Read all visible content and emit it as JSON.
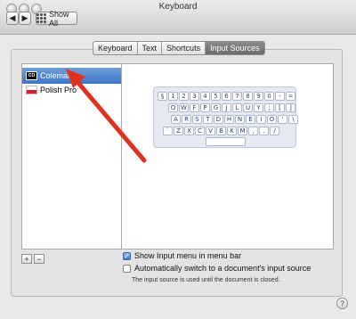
{
  "window": {
    "title": "Keyboard"
  },
  "toolbar": {
    "show_all_label": "Show All"
  },
  "tabs": [
    {
      "label": "Keyboard",
      "active": false
    },
    {
      "label": "Text",
      "active": false
    },
    {
      "label": "Shortcuts",
      "active": false
    },
    {
      "label": "Input Sources",
      "active": true
    }
  ],
  "input_sources": [
    {
      "badge": "CO",
      "label": "Colemak",
      "selected": true
    },
    {
      "badge": "PRO",
      "label": "Polish Pro",
      "selected": false
    }
  ],
  "keyboard_rows": [
    [
      "§",
      "1",
      "2",
      "3",
      "4",
      "5",
      "6",
      "7",
      "8",
      "9",
      "0",
      "-",
      "="
    ],
    [
      "Q",
      "W",
      "F",
      "P",
      "G",
      "J",
      "L",
      "U",
      "Y",
      ";",
      "[",
      "]"
    ],
    [
      "A",
      "R",
      "S",
      "T",
      "D",
      "H",
      "N",
      "E",
      "I",
      "O",
      "'",
      "\\"
    ],
    [
      "`",
      "Z",
      "X",
      "C",
      "V",
      "B",
      "K",
      "M",
      ",",
      ".",
      "/"
    ]
  ],
  "list_controls": {
    "add": "+",
    "remove": "−"
  },
  "options": {
    "show_menu": {
      "label": "Show Input menu in menu bar",
      "checked": true
    },
    "auto_switch": {
      "label": "Automatically switch to a document's input source",
      "checked": false
    },
    "note": "The input source is used until the document is closed."
  },
  "help_label": "?",
  "colors": {
    "selection": "#3b76c8",
    "arrow": "#e0301e"
  }
}
